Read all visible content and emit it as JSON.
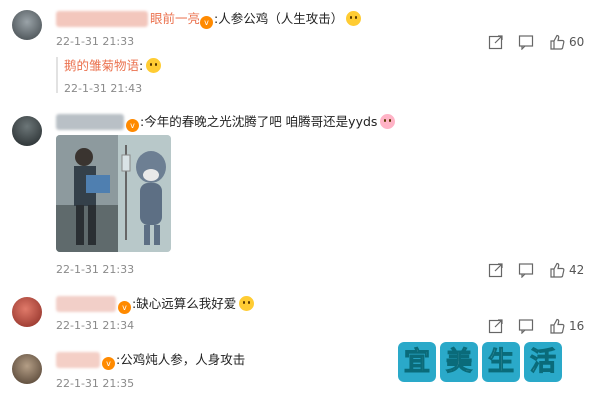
{
  "comments": [
    {
      "text": ":人参公鸡（人生攻击）",
      "name_visible": "眼前一亮",
      "time": "22-1-31 21:33",
      "like_count": "60",
      "reply": {
        "name": "鹅的雏菊物语",
        "text": ":",
        "time": "22-1-31 21:43"
      }
    },
    {
      "text": ":今年的春晚之光沈腾了吧 咱腾哥还是yyds",
      "time": "22-1-31 21:33",
      "like_count": "42"
    },
    {
      "text": ":缺心远算么我好爱",
      "time": "22-1-31 21:34",
      "like_count": "16"
    },
    {
      "text": ":公鸡炖人参，人身攻击",
      "time": "22-1-31 21:35"
    }
  ],
  "watermark": {
    "chars": [
      "宜",
      "美",
      "生",
      "活"
    ],
    "colors": [
      "#2aa9c9",
      "#2aa9c9",
      "#2aa9c9",
      "#2aa9c9"
    ]
  },
  "icons": {
    "share": "share-icon",
    "comment": "comment-icon",
    "like": "like-icon"
  },
  "colors": {
    "reply_name": "#eb7350",
    "time": "#8a8a8a"
  }
}
